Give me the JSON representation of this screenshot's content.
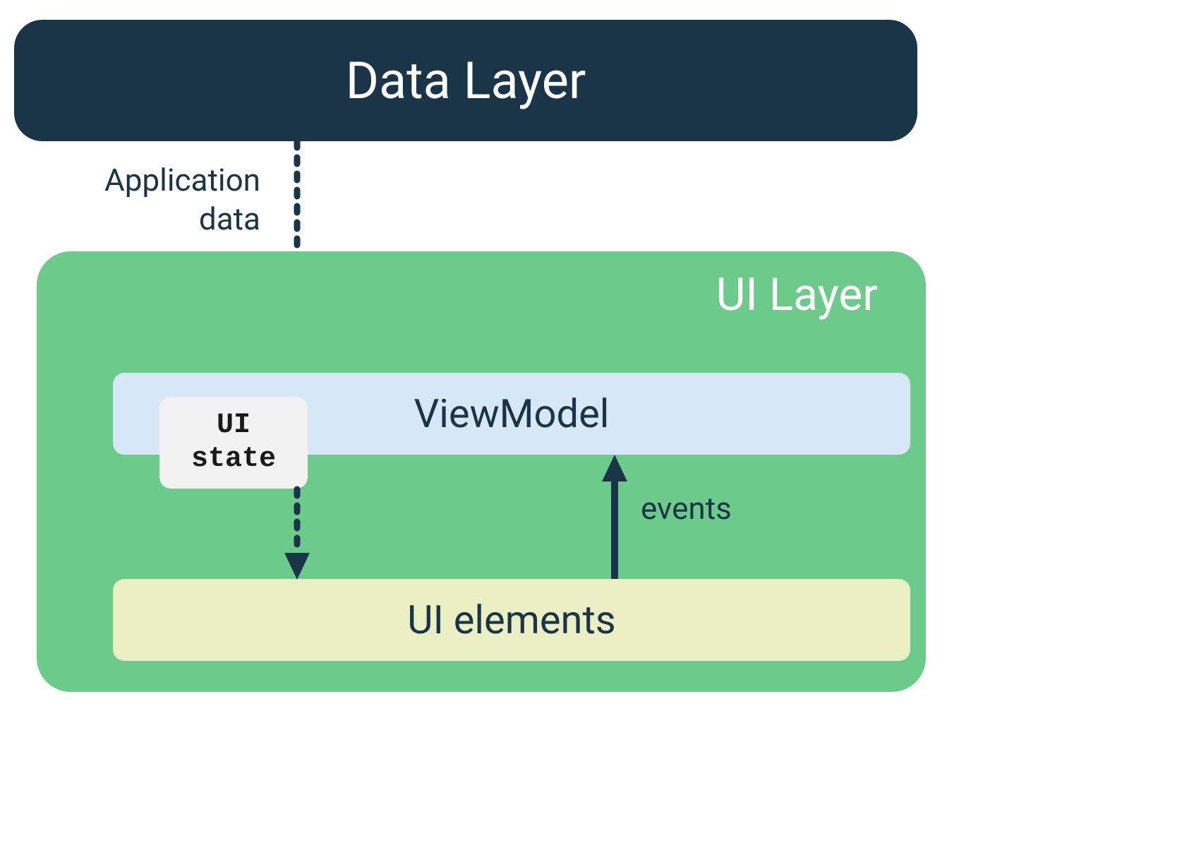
{
  "dataLayer": {
    "title": "Data Layer"
  },
  "arrows": {
    "applicationData": "Application\ndata",
    "events": "events"
  },
  "uiLayer": {
    "title": "UI Layer",
    "viewModel": "ViewModel",
    "uiState": "UI\nstate",
    "uiElements": "UI elements"
  },
  "colors": {
    "darkNavy": "#1a3547",
    "green": "#6ccb8b",
    "lightBlue": "#d6e8f5",
    "lightGray": "#f2f2f2",
    "lightYellow": "#eaf0c4",
    "white": "#ffffff"
  }
}
